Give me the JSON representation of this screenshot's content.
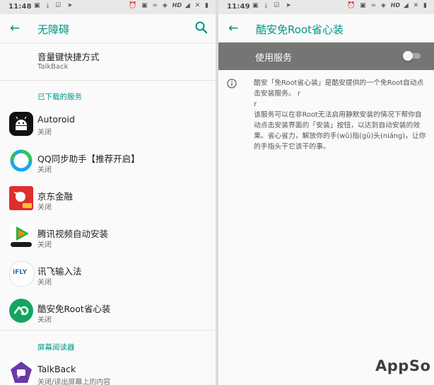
{
  "left": {
    "status": {
      "time": "11:48",
      "left_icons": "▣ ⤓ ☑ ➤",
      "right_icons": "⏰ ▣ ∞ ◈",
      "network": "HD",
      "signal": "◢ ✕ ▮"
    },
    "appbar": {
      "title": "无障碍"
    },
    "top_item": {
      "title": "音量键快捷方式",
      "subtitle": "TalkBack"
    },
    "section_downloaded": "已下载的服务",
    "services": [
      {
        "title": "Autoroid",
        "subtitle": "关闭",
        "icon": "android-robot-icon"
      },
      {
        "title": "QQ同步助手【推荐开启】",
        "subtitle": "关闭",
        "icon": "qq-sync-icon"
      },
      {
        "title": "京东金融",
        "subtitle": "关闭",
        "icon": "jd-finance-icon"
      },
      {
        "title": "腾讯视频自动安装",
        "subtitle": "关闭",
        "icon": "tencent-video-icon"
      },
      {
        "title": "讯飞输入法",
        "subtitle": "关闭",
        "icon": "ifly-icon"
      },
      {
        "title": "酷安免Root省心装",
        "subtitle": "关闭",
        "icon": "coolapk-icon"
      }
    ],
    "ifly_text": "iFLY",
    "section_screenreader": "屏幕阅读器",
    "talkback": {
      "title": "TalkBack",
      "subtitle": "关闭/读出屏幕上的内容"
    }
  },
  "right": {
    "status": {
      "time": "11:49",
      "left_icons": "▣ ⤓ ☑ ➤",
      "right_icons": "⏰ ▣ ∞ ◈",
      "network": "HD",
      "signal": "◢ ✕ ▮"
    },
    "appbar": {
      "title": "酷安免Root省心装"
    },
    "use_service": {
      "label": "使用服务",
      "enabled": false
    },
    "description": {
      "line1": "酷安「免Root省心装」是酷安提供的一个免Root自动点击安装服务。 r",
      "line2": "r",
      "line3": "该服务可以在非Root无法启用静默安装的情况下帮你自动点击安装界面的「安装」按钮，以达到自动安装的效果。省心省力，解放你的手(wǔ)指(gū)头(niáng)，让你的手指头干它该干的事。"
    }
  },
  "watermark": "AppSo",
  "colors": {
    "accent": "#009688",
    "service_bar": "#757575",
    "background": "#fafafa"
  }
}
